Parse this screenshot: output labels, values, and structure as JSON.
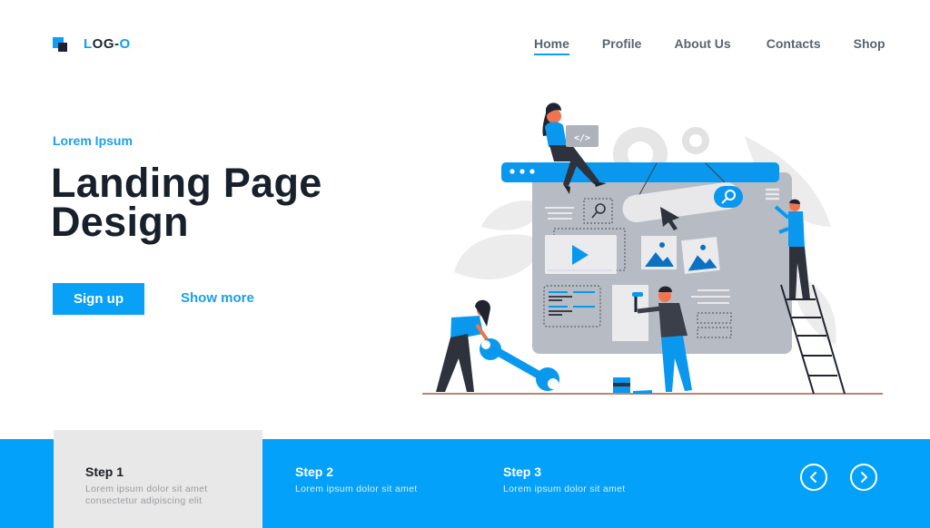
{
  "logo": {
    "prefix": "L",
    "middle": "OG-",
    "suffix": "O",
    "icon": "logo-squares-icon"
  },
  "nav": {
    "items": [
      {
        "label": "Home",
        "active": true
      },
      {
        "label": "Profile",
        "active": false
      },
      {
        "label": "About Us",
        "active": false
      },
      {
        "label": "Contacts",
        "active": false
      },
      {
        "label": "Shop",
        "active": false
      }
    ]
  },
  "hero": {
    "eyebrow": "Lorem Ipsum",
    "title_line1": "Landing Page",
    "title_line2": "Design",
    "primary_button": "Sign up",
    "secondary_link": "Show more",
    "illustration": "web-development-team-illustration"
  },
  "steps": [
    {
      "title": "Step 1",
      "desc_line1": "Lorem ipsum dolor sit amet",
      "desc_line2": "consectetur adipiscing elit",
      "active": true
    },
    {
      "title": "Step 2",
      "desc_line1": "Lorem ipsum dolor sit amet",
      "active": false
    },
    {
      "title": "Step 3",
      "desc_line1": "Lorem ipsum dolor sit amet",
      "active": false
    }
  ],
  "carousel": {
    "prev_icon": "chevron-left-icon",
    "next_icon": "chevron-right-icon"
  },
  "colors": {
    "accent": "#09a0f7",
    "dark": "#18202c",
    "step_bar": "#04a1fb",
    "step_active_bg": "#e8e8e9"
  }
}
